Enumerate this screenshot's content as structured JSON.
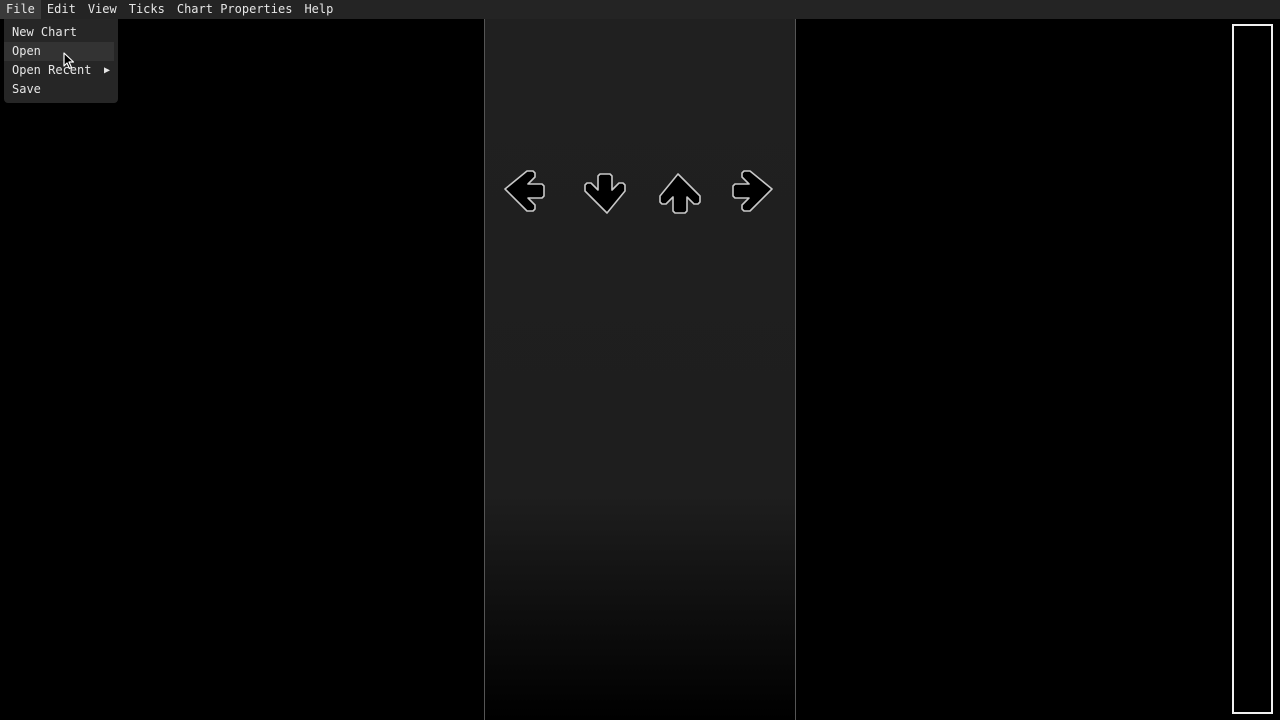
{
  "menubar": {
    "items": [
      "File",
      "Edit",
      "View",
      "Ticks",
      "Chart Properties",
      "Help"
    ],
    "active": "File"
  },
  "file_menu": {
    "items": [
      {
        "label": "New Chart"
      },
      {
        "label": "Open"
      },
      {
        "label": "Open Recent",
        "submenu_arrow": "▶"
      },
      {
        "label": "Save"
      }
    ],
    "hovered": "Open"
  },
  "receptors": [
    {
      "direction": "left",
      "icon": "left-arrow-receptor-icon"
    },
    {
      "direction": "down",
      "icon": "down-arrow-receptor-icon"
    },
    {
      "direction": "up",
      "icon": "up-arrow-receptor-icon"
    },
    {
      "direction": "right",
      "icon": "right-arrow-receptor-icon"
    }
  ],
  "colors": {
    "background": "#000000",
    "menubar": "#242424",
    "lane": "#202020",
    "receptor_outline": "#c8c8c8",
    "scrollbar_border": "#f0f0f0"
  }
}
